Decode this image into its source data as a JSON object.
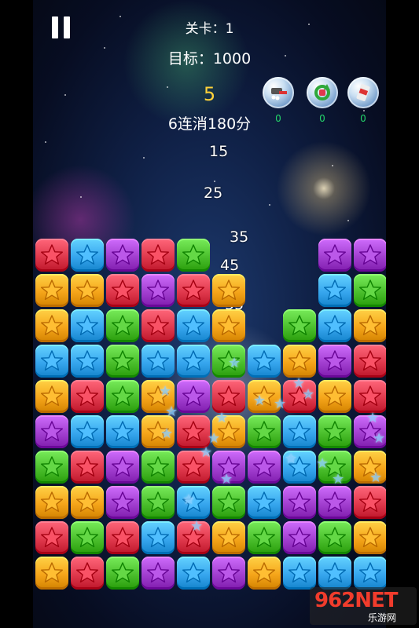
{
  "hud": {
    "level_label": "关卡：1",
    "target_label": "目标：1000",
    "combo_count": "5",
    "combo_text": "6连消180分"
  },
  "score_pops": [
    "15",
    "25",
    "35",
    "45",
    "55"
  ],
  "tools": [
    {
      "name": "hammer-tool",
      "count": "0"
    },
    {
      "name": "refresh-tool",
      "count": "0"
    },
    {
      "name": "bomb-tool",
      "count": "0"
    }
  ],
  "colors": {
    "R": "#e0394d",
    "Y": "#f5a51a",
    "B": "#37a6ee",
    "P": "#a23fd0",
    "G": "#4bbf2d",
    "combo": "#ffd23a",
    "tool_count": "#23d66a"
  },
  "board": {
    "rows": [
      "RBPRG..PP",
      "YYRPRY.BG",
      "YBGRBY.GBY",
      "BBGBBGB YR",
      "YRGYPRYYR",
      "PBBYRYGBGP",
      "GRPGRPPBGY",
      "YYPGBGBPPR",
      "RGRBRYGPGY",
      "YRGPBPYBBB"
    ],
    "grid": [
      [
        "R",
        "B",
        "P",
        "R",
        "G",
        "",
        "",
        "",
        "P",
        "P"
      ],
      [
        "Y",
        "Y",
        "R",
        "P",
        "R",
        "Y",
        "",
        "",
        "B",
        "G"
      ],
      [
        "Y",
        "B",
        "G",
        "R",
        "B",
        "Y",
        "",
        "G",
        "B",
        "Y"
      ],
      [
        "B",
        "B",
        "G",
        "B",
        "B",
        "G",
        "B",
        "Y",
        "P",
        "R"
      ],
      [
        "Y",
        "R",
        "G",
        "Y",
        "P",
        "R",
        "Y",
        "R",
        "Y",
        "R"
      ],
      [
        "P",
        "B",
        "B",
        "Y",
        "R",
        "Y",
        "G",
        "B",
        "G",
        "P"
      ],
      [
        "G",
        "R",
        "P",
        "G",
        "R",
        "P",
        "P",
        "B",
        "G",
        "Y"
      ],
      [
        "Y",
        "Y",
        "P",
        "G",
        "B",
        "G",
        "B",
        "P",
        "P",
        "R"
      ],
      [
        "R",
        "G",
        "R",
        "B",
        "R",
        "Y",
        "G",
        "P",
        "G",
        "Y"
      ],
      [
        "Y",
        "R",
        "G",
        "P",
        "B",
        "P",
        "Y",
        "B",
        "B",
        "B"
      ]
    ]
  },
  "watermark": {
    "logo": "962NET",
    "site": "乐游网"
  }
}
